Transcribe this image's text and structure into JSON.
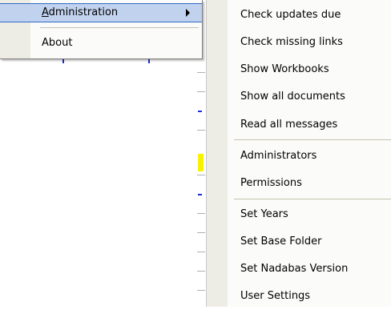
{
  "parent_menu": {
    "administration_label": "Administration",
    "about_label": "About"
  },
  "submenu": {
    "items": [
      {
        "label": "Check updates due"
      },
      {
        "label": "Check missing links"
      },
      {
        "label": "Show Workbooks"
      },
      {
        "label": "Show all documents"
      },
      {
        "label": "Read all messages"
      },
      {
        "label": "Administrators"
      },
      {
        "label": "Permissions"
      },
      {
        "label": "Set Years"
      },
      {
        "label": "Set Base Folder"
      },
      {
        "label": "Set Nadabas Version"
      },
      {
        "label": "User Settings"
      }
    ]
  },
  "icons": {
    "submenu_arrow": "chevron-right-icon"
  },
  "colors": {
    "highlight": "#c1d2ee",
    "highlight_border": "#316ac5",
    "menu_bg": "#fbfbf9",
    "gutter": "#eeede5"
  }
}
